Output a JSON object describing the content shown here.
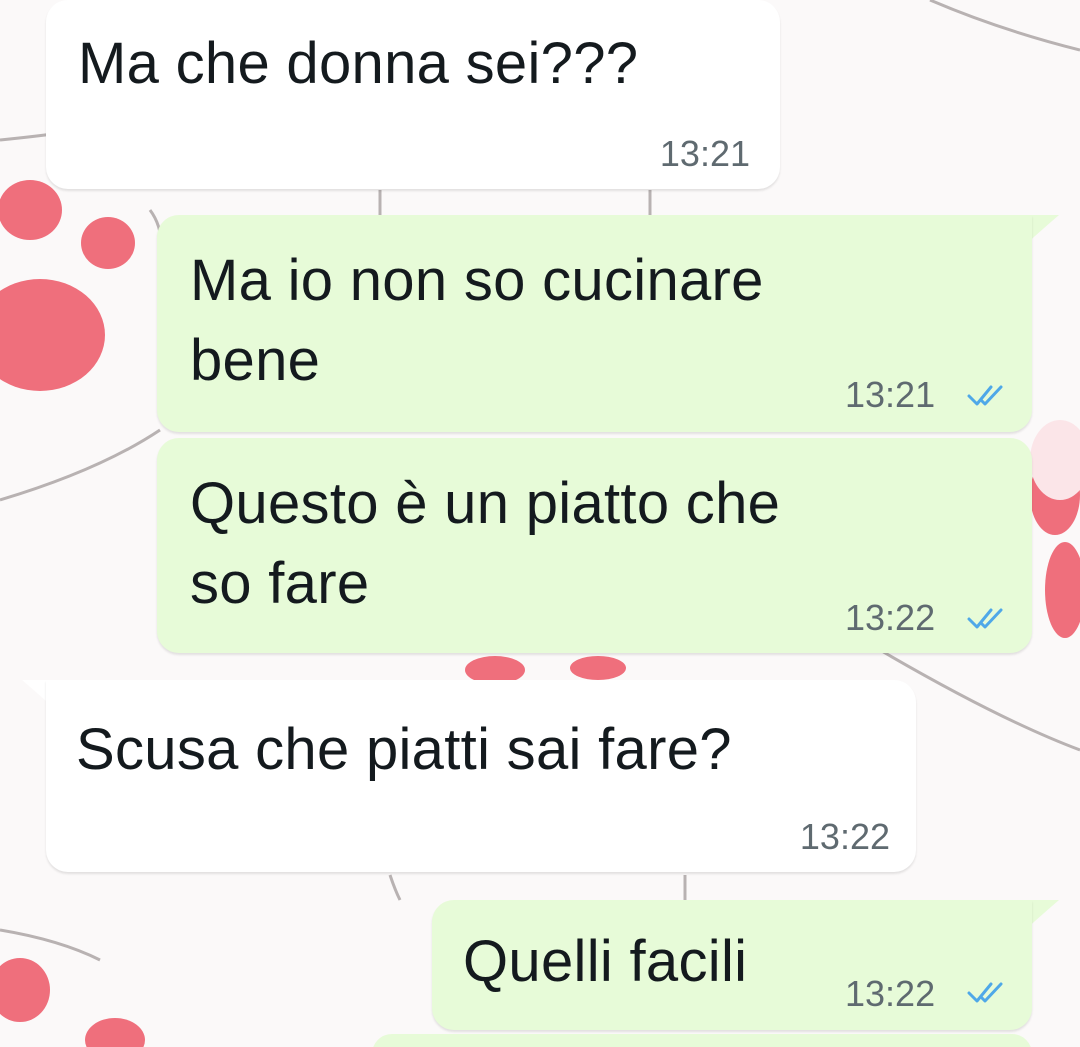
{
  "messages": [
    {
      "direction": "incoming",
      "text": "Ma che donna sei???",
      "time": "13:21"
    },
    {
      "direction": "outgoing",
      "text": "Ma io non so cucinare\nbene",
      "time": "13:21",
      "status": "read",
      "status_icon": "double-check-icon"
    },
    {
      "direction": "outgoing",
      "text": "Questo è un piatto che\nso fare",
      "time": "13:22",
      "status": "read",
      "status_icon": "double-check-icon"
    },
    {
      "direction": "incoming",
      "text": "Scusa che piatti sai fare?",
      "time": "13:22"
    },
    {
      "direction": "outgoing",
      "text": "Quelli facili",
      "time": "13:22",
      "status": "read",
      "status_icon": "double-check-icon"
    }
  ],
  "colors": {
    "incoming_bubble": "#ffffff",
    "outgoing_bubble": "#e7fbd8",
    "text": "#141a1e",
    "time": "#5f6a70",
    "read_ticks": "#4fa8e8",
    "wallpaper_paw": "#f0707a"
  }
}
